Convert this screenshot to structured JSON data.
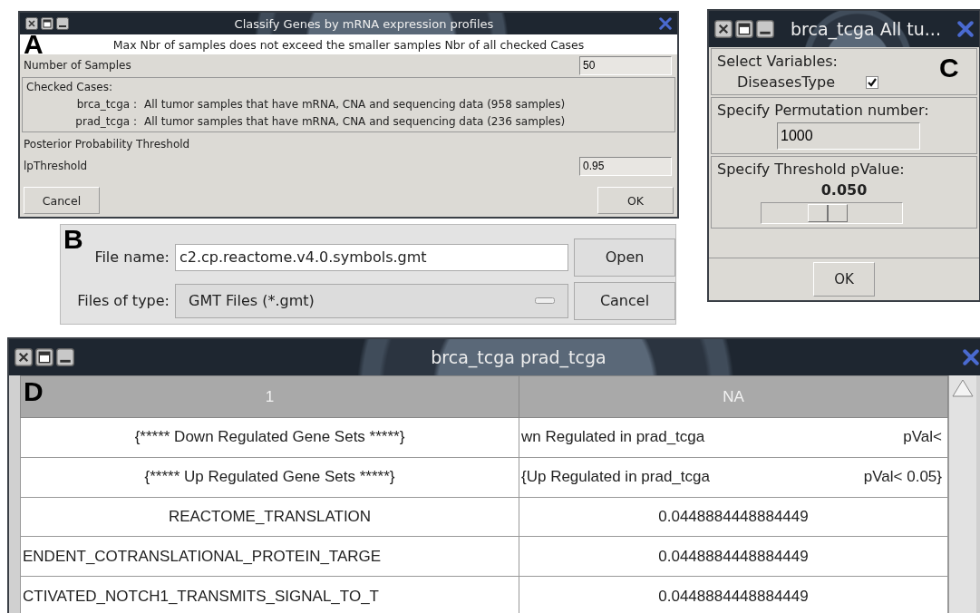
{
  "dialog_a": {
    "panel_label": "A",
    "title": "Classify Genes by mRNA expression profiles",
    "notice": "Max Nbr of samples does not exceed the smaller samples Nbr of all checked Cases",
    "samples_label": "Number of Samples",
    "samples_value": "50",
    "cases_heading": "Checked Cases:",
    "cases": [
      {
        "name": "brca_tcga :",
        "description": "All tumor samples that have mRNA, CNA and sequencing data (958 samples)"
      },
      {
        "name": "prad_tcga :",
        "description": "All tumor samples that have mRNA, CNA and sequencing data (236 samples)"
      }
    ],
    "threshold_heading": "Posterior Probability Threshold",
    "threshold_label": "lpThreshold",
    "threshold_value": "0.95",
    "buttons": [
      "Cancel",
      "OK"
    ]
  },
  "file_dialog_b": {
    "panel_label": "B",
    "file_name_label": "File name:",
    "file_name": "c2.cp.reactome.v4.0.symbols.gmt",
    "file_type_label": "Files of type:",
    "file_type": "GMT Files (*.gmt)",
    "buttons": [
      "Open",
      "Cancel"
    ]
  },
  "dialog_c": {
    "panel_label": "C",
    "title": "brca_tcga All tu...",
    "variables_heading": "Select Variables:",
    "variables": [
      {
        "label": "DiseasesType",
        "checked": true
      }
    ],
    "permutation_heading": "Specify Permutation number:",
    "permutation_value": "1000",
    "pvalue_heading": "Specify Threshold pValue:",
    "pvalue_reading": "0.050",
    "pvalue_slider": {
      "level": 0.47
    },
    "button": "OK"
  },
  "table_d": {
    "panel_label": "D",
    "title": "brca_tcga prad_tcga",
    "columns": [
      "1",
      "NA"
    ],
    "rows": [
      [
        {
          "text": "{***** Down Regulated Gene Sets *****}",
          "clipped": false
        },
        {
          "parts": [
            "wn Regulated in prad_tcga",
            "pVal<"
          ]
        }
      ],
      [
        {
          "text": "{***** Up Regulated Gene Sets *****}",
          "clipped": false
        },
        {
          "parts": [
            "{Up Regulated in prad_tcga",
            "pVal< 0.05}"
          ]
        }
      ],
      [
        {
          "text": "REACTOME_TRANSLATION",
          "clipped": false
        },
        {
          "text": "0.0448884448884449",
          "clipped": false
        }
      ],
      [
        {
          "text": "ENDENT_COTRANSLATIONAL_PROTEIN_TARGE",
          "clipped": true
        },
        {
          "text": "0.0448884448884449",
          "clipped": false
        }
      ],
      [
        {
          "text": "CTIVATED_NOTCH1_TRANSMITS_SIGNAL_TO_T",
          "clipped": true
        },
        {
          "text": "0.0448884448884449",
          "clipped": false
        }
      ]
    ]
  }
}
